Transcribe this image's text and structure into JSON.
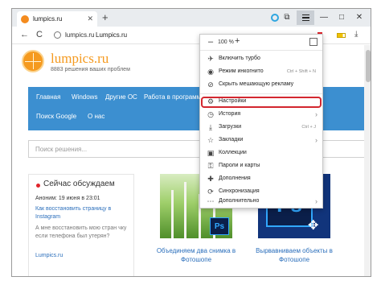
{
  "browser": {
    "tab": {
      "title": "lumpics.ru",
      "close": "✕"
    },
    "new_tab": "+",
    "window_controls": {
      "minimize": "—",
      "maximize": "□",
      "close": "✕"
    },
    "nav": {
      "back": "←",
      "reload": "C",
      "host": "lumpics.ru",
      "title": "Lumpics.ru"
    },
    "colors": {
      "accent": "#3c8fd0",
      "alert": "#d3272f",
      "brand": "#f59a1f"
    }
  },
  "site": {
    "name": "lumpics.ru",
    "tagline": "8883 решения ваших проблем",
    "nav": [
      "Главная",
      "Windows",
      "Другие ОС",
      "Работа в программ",
      "Поиск Google",
      "О нас"
    ],
    "search_placeholder": "Поиск решения...",
    "sidebar": {
      "title": "Сейчас обсуждаем",
      "meta": "Аноним: 19 июня в 23:01",
      "link1": "Как восстановить страницу в Instagram",
      "comment": "А мне восстановить мою стран чку если телефона был утерян?",
      "link2": "Lumpics.ru"
    },
    "articles": [
      {
        "caption": "Объединяем два снимка в Фотошопе",
        "badge": "Ps"
      },
      {
        "caption": "Вырвавниваем объекты в Фотошопе",
        "badge": "Ps"
      }
    ]
  },
  "menu": {
    "zoom": {
      "minus": "–",
      "value": "100 %",
      "plus": "+"
    },
    "items": [
      {
        "label": "Включить турбо",
        "icon": "rocket-icon",
        "glyph": "✈",
        "hint": ""
      },
      {
        "label": "Режим инкогнито",
        "icon": "incognito-icon",
        "glyph": "◉",
        "hint": "Ctrl + Shift + N"
      },
      {
        "label": "Скрыть мешающую рекламу",
        "icon": "shield-icon",
        "glyph": "⊘",
        "hint": ""
      },
      {
        "label": "Настройки",
        "icon": "gear-icon",
        "glyph": "⚙",
        "hint": "",
        "highlighted": true
      },
      {
        "label": "История",
        "icon": "history-icon",
        "glyph": "◷",
        "hint": "",
        "arrow": "›"
      },
      {
        "label": "Загрузки",
        "icon": "download-icon",
        "glyph": "⤓",
        "hint": "Ctrl + J"
      },
      {
        "label": "Закладки",
        "icon": "bookmark-icon",
        "glyph": "☆",
        "hint": "",
        "arrow": "›"
      },
      {
        "label": "Коллекции",
        "icon": "collections-icon",
        "glyph": "▣",
        "hint": ""
      },
      {
        "label": "Пароли и карты",
        "icon": "key-icon",
        "glyph": "⚿",
        "hint": ""
      },
      {
        "label": "Дополнения",
        "icon": "puzzle-icon",
        "glyph": "✚",
        "hint": ""
      },
      {
        "label": "Синхронизация",
        "icon": "sync-icon",
        "glyph": "⟳",
        "hint": ""
      },
      {
        "label": "Дополнительно",
        "icon": "more-icon",
        "glyph": "⋯",
        "hint": "",
        "arrow": "›"
      }
    ]
  }
}
